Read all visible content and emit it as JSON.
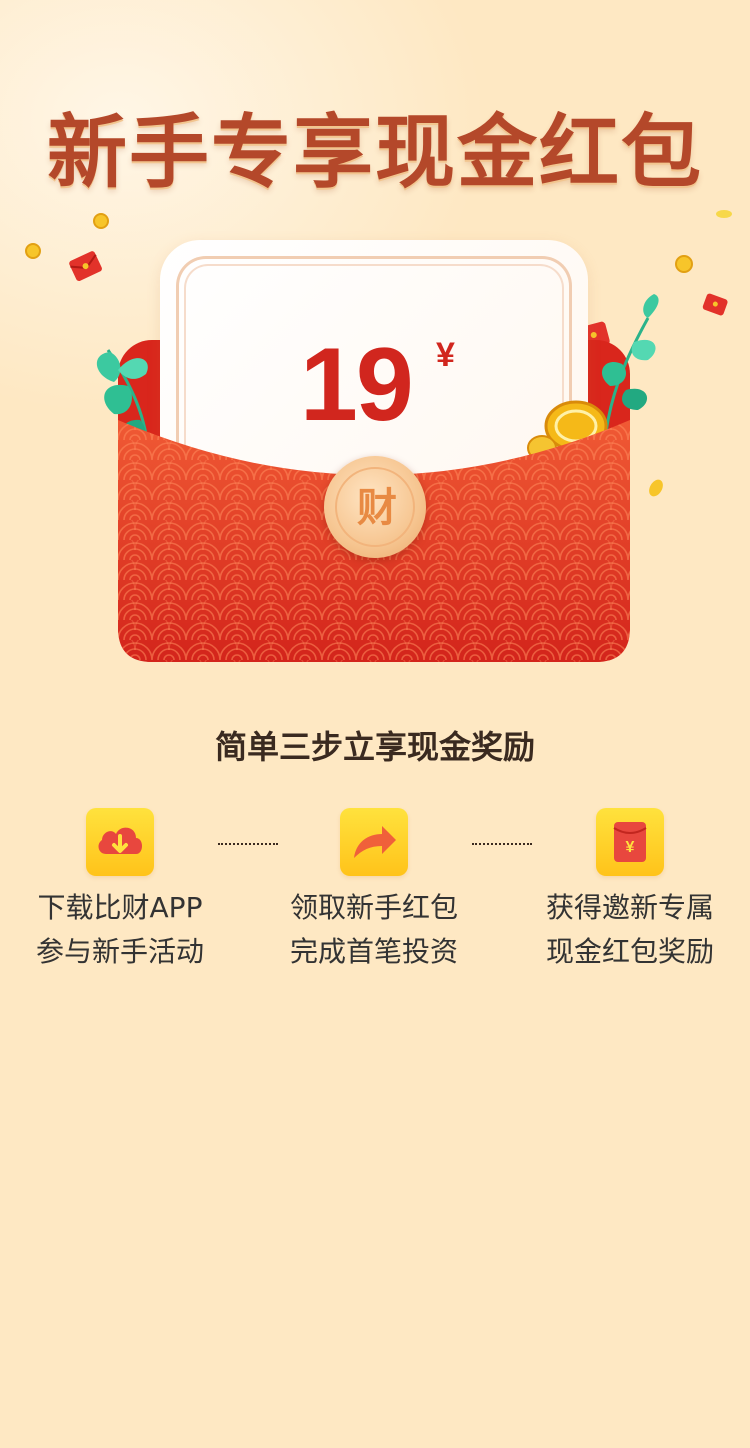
{
  "headline": "新手专享现金红包",
  "envelope": {
    "amount": "19",
    "currency": "¥",
    "seal_char": "财"
  },
  "steps_title": "简单三步立享现金奖励",
  "steps": [
    {
      "icon": "cloud-download-icon",
      "line1": "下载比财APP",
      "line2": "参与新手活动"
    },
    {
      "icon": "share-arrow-icon",
      "line1": "领取新手红包",
      "line2": "完成首笔投资"
    },
    {
      "icon": "red-envelope-icon",
      "line1": "获得邀新专属",
      "line2": "现金红包奖励"
    }
  ],
  "colors": {
    "background": "#fee8c3",
    "headline": "#b4482a",
    "envelope_red": "#d9261c",
    "amount": "#d1261e",
    "icon_yellow": "#ffc31a"
  }
}
